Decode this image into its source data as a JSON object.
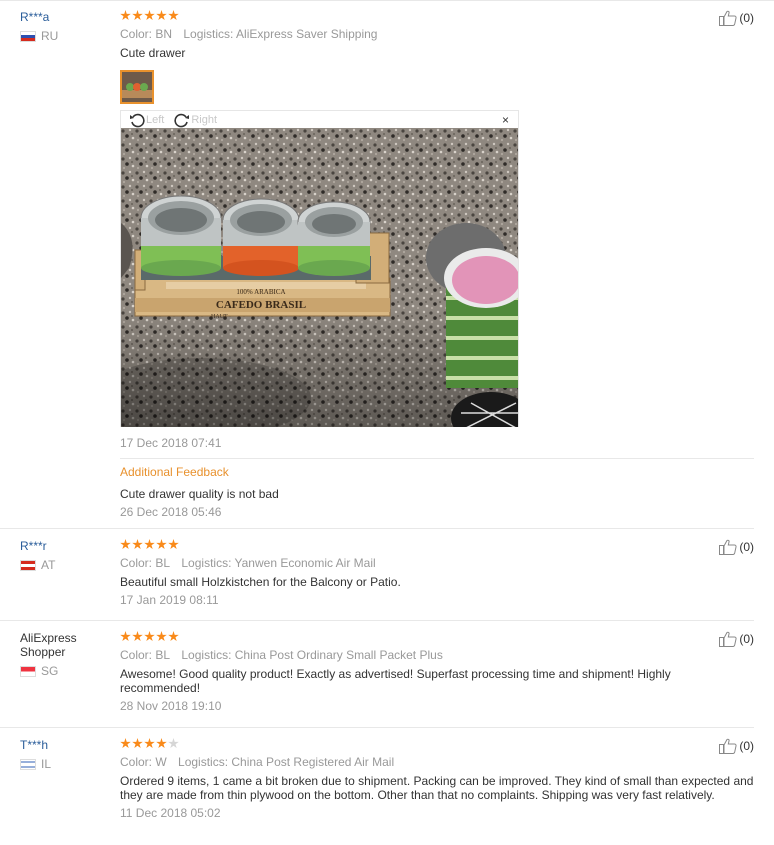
{
  "reviews": [
    {
      "user": "R***a",
      "country": "RU",
      "stars": 5,
      "color": "Color: BN",
      "logistics": "Logistics: AliExpress Saver Shipping",
      "text": "Cute drawer",
      "date": "17 Dec 2018 07:41",
      "helpful": "(0)",
      "additional_label": "Additional Feedback",
      "additional_text": "Cute drawer quality is not bad",
      "additional_date": "26 Dec 2018 05:46",
      "viewer": {
        "left_label": "Left",
        "right_label": "Right",
        "close": "×"
      }
    },
    {
      "user": "R***r",
      "country": "AT",
      "stars": 5,
      "color": "Color: BL",
      "logistics": "Logistics: Yanwen Economic Air Mail",
      "text": "Beautiful small Holzkistchen for the Balcony or Patio.",
      "date": "17 Jan 2019 08:11",
      "helpful": "(0)"
    },
    {
      "user_line1": "AliExpress",
      "user_line2": "Shopper",
      "country": "SG",
      "stars": 5,
      "color": "Color: BL",
      "logistics": "Logistics: China Post Ordinary Small Packet Plus",
      "text": "Awesome! Good quality product! Exactly as advertised! Superfast processing time and shipment! Highly recommended!",
      "date": "28 Nov 2018 19:10",
      "helpful": "(0)"
    },
    {
      "user": "T***h",
      "country": "IL",
      "stars": 4,
      "color": "Color: W",
      "logistics": "Logistics: China Post Registered Air Mail",
      "text": "Ordered 9 items, 1 came a bit broken due to shipment. Packing can be improved. They kind of small than expected and they are made from thin plywood on the bottom. Other than that no complaints. Shipping was very fast relatively.",
      "date": "11 Dec 2018 05:02",
      "helpful": "(0)"
    }
  ],
  "photo_text": {
    "line1": "100% ARABICA",
    "line2": "CAFEDO BRASIL",
    "line3": "HAUT"
  },
  "colors": {
    "accent": "#e8912d",
    "star": "#f98a1a",
    "link": "#2a5d9a"
  }
}
